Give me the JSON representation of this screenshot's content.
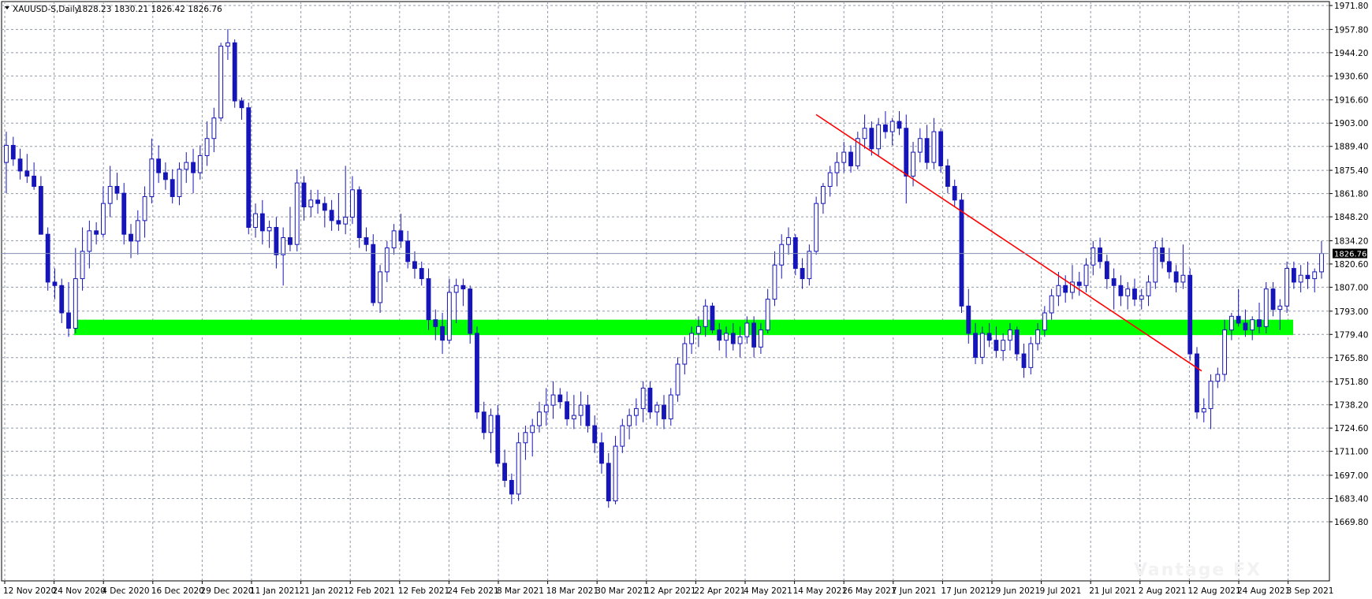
{
  "window": {
    "symbol_label": "XAUUSD-S,Daily",
    "ohlc_label": "1828.23 1830.21 1826.42 1826.76",
    "watermark": "Vantage FX"
  },
  "colors": {
    "candle": "#1515b8",
    "support_zone": "#00ff00",
    "trendline": "#ff0000",
    "grid": "#9098a8",
    "price_line": "#8090b0",
    "price_badge_bg": "#000000",
    "price_badge_fg": "#ffffff"
  },
  "chart_data": {
    "type": "candlestick",
    "symbol": "XAUUSD-S",
    "timeframe": "Daily",
    "current_price": 1826.76,
    "current_price_label": "1826.76",
    "y_axis": {
      "range": [
        1669.8,
        1971.8
      ],
      "tick_labels": [
        "1971.80",
        "1957.80",
        "1944.20",
        "1930.60",
        "1916.60",
        "1903.00",
        "1889.40",
        "1875.40",
        "1861.80",
        "1848.20",
        "1834.20",
        "1820.60",
        "1807.00",
        "1793.00",
        "1779.40",
        "1765.80",
        "1751.80",
        "1738.20",
        "1724.60",
        "1711.00",
        "1697.00",
        "1683.40",
        "1669.80"
      ]
    },
    "x_axis": {
      "tick_labels": [
        "12 Nov 2020",
        "24 Nov 2020",
        "4 Dec 2020",
        "16 Dec 2020",
        "29 Dec 2020",
        "11 Jan 2021",
        "21 Jan 2021",
        "2 Feb 2021",
        "12 Feb 2021",
        "24 Feb 2021",
        "8 Mar 2021",
        "18 Mar 2021",
        "30 Mar 2021",
        "12 Apr 2021",
        "22 Apr 2021",
        "4 May 2021",
        "14 May 2021",
        "26 May 2021",
        "7 Jun 2021",
        "17 Jun 2021",
        "29 Jun 2021",
        "9 Jul 2021",
        "21 Jul 2021",
        "2 Aug 2021",
        "12 Aug 2021",
        "24 Aug 2021",
        "3 Sep 2021"
      ]
    },
    "support_zone": {
      "low": 1779.0,
      "high": 1788.0,
      "start": "24 Nov 2020",
      "end": "27 Aug 2021"
    },
    "trendline": {
      "start": {
        "date": "4 Jun 2021",
        "price": 1908.0
      },
      "end": {
        "date": "6 Sep 2021",
        "price": 1758.0
      }
    },
    "candles": [
      [
        1880,
        1898,
        1862,
        1890
      ],
      [
        1890,
        1895,
        1878,
        1882
      ],
      [
        1882,
        1888,
        1870,
        1875
      ],
      [
        1875,
        1885,
        1868,
        1872
      ],
      [
        1872,
        1880,
        1864,
        1866
      ],
      [
        1866,
        1872,
        1842,
        1838
      ],
      [
        1838,
        1842,
        1805,
        1810
      ],
      [
        1810,
        1818,
        1800,
        1808
      ],
      [
        1808,
        1812,
        1786,
        1792
      ],
      [
        1792,
        1810,
        1778,
        1783
      ],
      [
        1783,
        1830,
        1780,
        1812
      ],
      [
        1812,
        1842,
        1805,
        1828
      ],
      [
        1828,
        1846,
        1818,
        1840
      ],
      [
        1840,
        1845,
        1832,
        1838
      ],
      [
        1838,
        1866,
        1836,
        1856
      ],
      [
        1856,
        1878,
        1848,
        1866
      ],
      [
        1866,
        1874,
        1858,
        1862
      ],
      [
        1862,
        1868,
        1832,
        1838
      ],
      [
        1838,
        1844,
        1824,
        1834
      ],
      [
        1834,
        1852,
        1826,
        1846
      ],
      [
        1846,
        1866,
        1836,
        1860
      ],
      [
        1860,
        1894,
        1856,
        1882
      ],
      [
        1882,
        1890,
        1868,
        1874
      ],
      [
        1874,
        1880,
        1864,
        1870
      ],
      [
        1870,
        1876,
        1856,
        1860
      ],
      [
        1860,
        1880,
        1855,
        1876
      ],
      [
        1876,
        1886,
        1868,
        1880
      ],
      [
        1880,
        1888,
        1862,
        1874
      ],
      [
        1874,
        1890,
        1870,
        1884
      ],
      [
        1884,
        1904,
        1878,
        1894
      ],
      [
        1894,
        1912,
        1886,
        1906
      ],
      [
        1906,
        1950,
        1904,
        1948
      ],
      [
        1948,
        1958,
        1940,
        1950
      ],
      [
        1950,
        1952,
        1912,
        1916
      ],
      [
        1916,
        1918,
        1905,
        1912
      ],
      [
        1912,
        1915,
        1838,
        1842
      ],
      [
        1842,
        1856,
        1836,
        1850
      ],
      [
        1850,
        1858,
        1832,
        1840
      ],
      [
        1840,
        1846,
        1830,
        1842
      ],
      [
        1842,
        1848,
        1818,
        1826
      ],
      [
        1826,
        1842,
        1808,
        1836
      ],
      [
        1836,
        1854,
        1828,
        1832
      ],
      [
        1832,
        1876,
        1828,
        1868
      ],
      [
        1868,
        1872,
        1846,
        1854
      ],
      [
        1854,
        1864,
        1848,
        1858
      ],
      [
        1858,
        1864,
        1850,
        1856
      ],
      [
        1856,
        1860,
        1842,
        1852
      ],
      [
        1852,
        1858,
        1840,
        1846
      ],
      [
        1846,
        1862,
        1840,
        1844
      ],
      [
        1844,
        1878,
        1838,
        1848
      ],
      [
        1848,
        1872,
        1844,
        1864
      ],
      [
        1864,
        1866,
        1830,
        1836
      ],
      [
        1836,
        1842,
        1828,
        1832
      ],
      [
        1832,
        1838,
        1796,
        1798
      ],
      [
        1798,
        1820,
        1792,
        1816
      ],
      [
        1816,
        1834,
        1810,
        1830
      ],
      [
        1830,
        1844,
        1826,
        1840
      ],
      [
        1840,
        1850,
        1830,
        1834
      ],
      [
        1834,
        1840,
        1818,
        1822
      ],
      [
        1822,
        1828,
        1812,
        1818
      ],
      [
        1818,
        1822,
        1808,
        1812
      ],
      [
        1812,
        1818,
        1782,
        1788
      ],
      [
        1788,
        1794,
        1776,
        1784
      ],
      [
        1784,
        1792,
        1768,
        1776
      ],
      [
        1776,
        1812,
        1774,
        1804
      ],
      [
        1804,
        1812,
        1786,
        1808
      ],
      [
        1808,
        1812,
        1796,
        1806
      ],
      [
        1806,
        1808,
        1774,
        1780
      ],
      [
        1780,
        1784,
        1730,
        1734
      ],
      [
        1734,
        1740,
        1718,
        1722
      ],
      [
        1722,
        1736,
        1710,
        1732
      ],
      [
        1732,
        1738,
        1702,
        1704
      ],
      [
        1704,
        1712,
        1690,
        1694
      ],
      [
        1694,
        1698,
        1680,
        1686
      ],
      [
        1686,
        1722,
        1682,
        1716
      ],
      [
        1716,
        1726,
        1706,
        1722
      ],
      [
        1722,
        1730,
        1708,
        1726
      ],
      [
        1726,
        1740,
        1722,
        1734
      ],
      [
        1734,
        1748,
        1726,
        1738
      ],
      [
        1738,
        1752,
        1730,
        1744
      ],
      [
        1744,
        1748,
        1736,
        1740
      ],
      [
        1740,
        1746,
        1726,
        1730
      ],
      [
        1730,
        1744,
        1724,
        1732
      ],
      [
        1732,
        1746,
        1726,
        1738
      ],
      [
        1738,
        1744,
        1722,
        1726
      ],
      [
        1726,
        1732,
        1710,
        1716
      ],
      [
        1716,
        1722,
        1698,
        1704
      ],
      [
        1704,
        1710,
        1678,
        1682
      ],
      [
        1682,
        1720,
        1680,
        1714
      ],
      [
        1714,
        1730,
        1710,
        1726
      ],
      [
        1726,
        1736,
        1718,
        1732
      ],
      [
        1732,
        1742,
        1726,
        1736
      ],
      [
        1736,
        1752,
        1728,
        1748
      ],
      [
        1748,
        1752,
        1730,
        1734
      ],
      [
        1734,
        1740,
        1726,
        1738
      ],
      [
        1738,
        1744,
        1724,
        1730
      ],
      [
        1730,
        1748,
        1726,
        1744
      ],
      [
        1744,
        1766,
        1740,
        1762
      ],
      [
        1762,
        1778,
        1756,
        1774
      ],
      [
        1774,
        1784,
        1768,
        1780
      ],
      [
        1780,
        1790,
        1772,
        1784
      ],
      [
        1784,
        1800,
        1778,
        1796
      ],
      [
        1796,
        1798,
        1780,
        1782
      ],
      [
        1782,
        1786,
        1770,
        1776
      ],
      [
        1776,
        1784,
        1766,
        1780
      ],
      [
        1780,
        1786,
        1770,
        1774
      ],
      [
        1774,
        1784,
        1766,
        1778
      ],
      [
        1778,
        1790,
        1774,
        1786
      ],
      [
        1786,
        1790,
        1766,
        1772
      ],
      [
        1772,
        1786,
        1768,
        1782
      ],
      [
        1782,
        1806,
        1780,
        1800
      ],
      [
        1800,
        1828,
        1796,
        1820
      ],
      [
        1820,
        1838,
        1812,
        1832
      ],
      [
        1832,
        1842,
        1826,
        1836
      ],
      [
        1836,
        1838,
        1814,
        1818
      ],
      [
        1818,
        1824,
        1806,
        1812
      ],
      [
        1812,
        1832,
        1808,
        1828
      ],
      [
        1828,
        1860,
        1826,
        1856
      ],
      [
        1856,
        1868,
        1850,
        1866
      ],
      [
        1866,
        1878,
        1860,
        1874
      ],
      [
        1874,
        1886,
        1866,
        1880
      ],
      [
        1880,
        1892,
        1874,
        1886
      ],
      [
        1886,
        1890,
        1874,
        1878
      ],
      [
        1878,
        1898,
        1876,
        1894
      ],
      [
        1894,
        1908,
        1888,
        1900
      ],
      [
        1900,
        1904,
        1884,
        1888
      ],
      [
        1888,
        1906,
        1884,
        1902
      ],
      [
        1902,
        1910,
        1894,
        1898
      ],
      [
        1898,
        1906,
        1890,
        1904
      ],
      [
        1904,
        1910,
        1896,
        1900
      ],
      [
        1900,
        1908,
        1856,
        1872
      ],
      [
        1872,
        1892,
        1866,
        1886
      ],
      [
        1886,
        1900,
        1880,
        1894
      ],
      [
        1894,
        1902,
        1876,
        1880
      ],
      [
        1880,
        1906,
        1876,
        1898
      ],
      [
        1898,
        1900,
        1874,
        1878
      ],
      [
        1878,
        1882,
        1862,
        1866
      ],
      [
        1866,
        1870,
        1854,
        1858
      ],
      [
        1858,
        1862,
        1792,
        1796
      ],
      [
        1796,
        1806,
        1774,
        1780
      ],
      [
        1780,
        1786,
        1762,
        1766
      ],
      [
        1766,
        1784,
        1762,
        1780
      ],
      [
        1780,
        1786,
        1772,
        1776
      ],
      [
        1776,
        1784,
        1766,
        1770
      ],
      [
        1770,
        1780,
        1764,
        1776
      ],
      [
        1776,
        1786,
        1770,
        1782
      ],
      [
        1782,
        1784,
        1764,
        1768
      ],
      [
        1768,
        1774,
        1754,
        1760
      ],
      [
        1760,
        1778,
        1756,
        1774
      ],
      [
        1774,
        1786,
        1770,
        1782
      ],
      [
        1782,
        1796,
        1778,
        1792
      ],
      [
        1792,
        1806,
        1788,
        1802
      ],
      [
        1802,
        1816,
        1796,
        1808
      ],
      [
        1808,
        1814,
        1798,
        1804
      ],
      [
        1804,
        1820,
        1800,
        1810
      ],
      [
        1810,
        1816,
        1802,
        1808
      ],
      [
        1808,
        1824,
        1804,
        1820
      ],
      [
        1820,
        1834,
        1814,
        1830
      ],
      [
        1830,
        1836,
        1818,
        1822
      ],
      [
        1822,
        1826,
        1806,
        1812
      ],
      [
        1812,
        1818,
        1794,
        1808
      ],
      [
        1808,
        1814,
        1796,
        1802
      ],
      [
        1802,
        1810,
        1794,
        1806
      ],
      [
        1806,
        1812,
        1796,
        1800
      ],
      [
        1800,
        1806,
        1794,
        1802
      ],
      [
        1802,
        1814,
        1796,
        1810
      ],
      [
        1810,
        1834,
        1806,
        1830
      ],
      [
        1830,
        1836,
        1818,
        1822
      ],
      [
        1822,
        1830,
        1812,
        1816
      ],
      [
        1816,
        1820,
        1804,
        1810
      ],
      [
        1810,
        1832,
        1806,
        1814
      ],
      [
        1814,
        1818,
        1764,
        1768
      ],
      [
        1768,
        1772,
        1730,
        1734
      ],
      [
        1734,
        1742,
        1728,
        1736
      ],
      [
        1736,
        1756,
        1724,
        1752
      ],
      [
        1752,
        1760,
        1748,
        1756
      ],
      [
        1756,
        1788,
        1752,
        1782
      ],
      [
        1782,
        1792,
        1776,
        1790
      ],
      [
        1790,
        1806,
        1784,
        1786
      ],
      [
        1786,
        1794,
        1778,
        1782
      ],
      [
        1782,
        1790,
        1776,
        1788
      ],
      [
        1788,
        1798,
        1780,
        1784
      ],
      [
        1784,
        1810,
        1780,
        1806
      ],
      [
        1806,
        1810,
        1790,
        1794
      ],
      [
        1794,
        1800,
        1782,
        1796
      ],
      [
        1796,
        1822,
        1792,
        1818
      ],
      [
        1818,
        1822,
        1806,
        1810
      ],
      [
        1810,
        1820,
        1804,
        1814
      ],
      [
        1814,
        1822,
        1806,
        1812
      ],
      [
        1812,
        1818,
        1804,
        1816
      ],
      [
        1816,
        1834,
        1812,
        1826.76
      ]
    ]
  }
}
